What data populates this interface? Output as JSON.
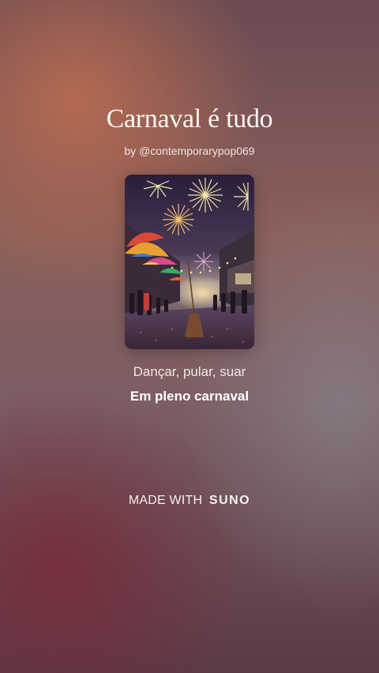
{
  "song": {
    "title": "Carnaval é tudo",
    "byline": "by @contemporarypop069"
  },
  "cover": {
    "icon": "carnival-street-fireworks-artwork"
  },
  "lyrics": {
    "line1": "Dançar, pular, suar",
    "line2": "Em pleno carnaval"
  },
  "footer": {
    "made_with": "MADE WITH",
    "brand": "SUNO"
  }
}
